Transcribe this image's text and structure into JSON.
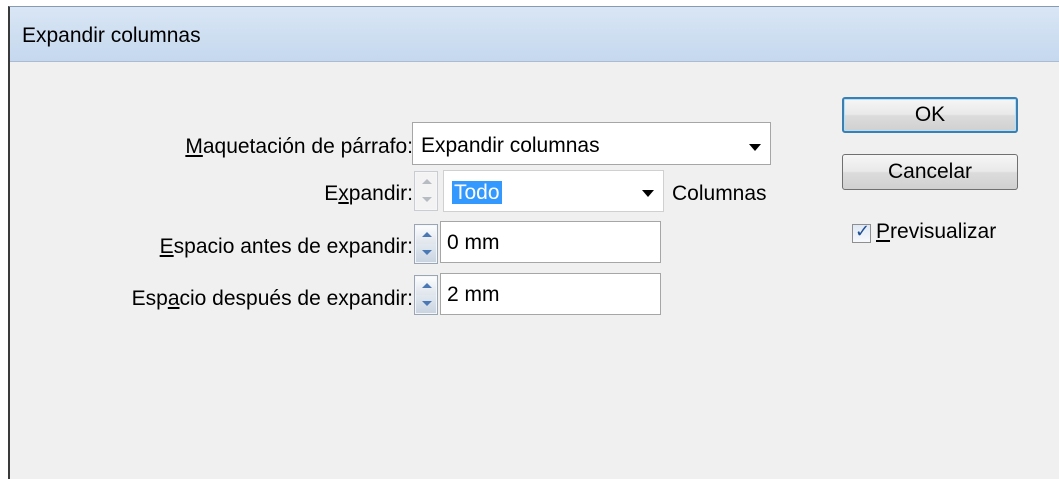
{
  "window": {
    "title": "Expandir columnas"
  },
  "form": {
    "layout": {
      "label_pre": "",
      "label_ul": "M",
      "label_post": "aquetación de párrafo:",
      "value": "Expandir columnas"
    },
    "span": {
      "label_pre": "E",
      "label_ul": "x",
      "label_post": "pandir:",
      "value": "Todo",
      "suffix": "Columnas",
      "enabled": false
    },
    "space_before": {
      "label_pre": "",
      "label_ul": "E",
      "label_post": "spacio antes de expandir:",
      "value": "0 mm"
    },
    "space_after": {
      "label_pre": "Esp",
      "label_ul": "a",
      "label_post": "cio después de expandir:",
      "value": "2 mm"
    }
  },
  "buttons": {
    "ok": "OK",
    "cancel": "Cancelar"
  },
  "preview": {
    "label_ul": "P",
    "label_post": "revisualizar",
    "checked": true,
    "mark": "✓"
  },
  "icons": {
    "up_arrow": "spinner-up-icon",
    "down_arrow": "spinner-down-icon",
    "caret": "chevron-down-icon"
  }
}
